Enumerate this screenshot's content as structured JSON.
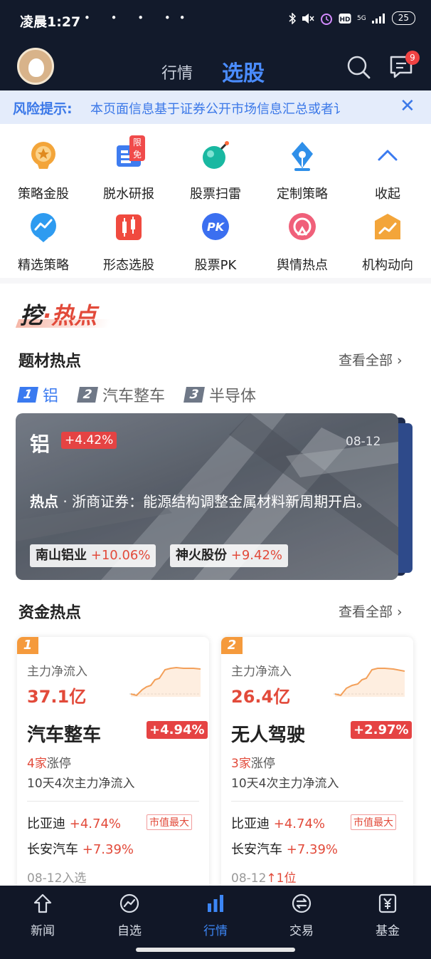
{
  "status_bar": {
    "time": "凌晨1:27",
    "left_icons": "• • • ••",
    "net": "5G",
    "battery": "25"
  },
  "header": {
    "tabs": [
      "行情",
      "选股"
    ],
    "active_tab": "选股",
    "message_badge": "9",
    "colors": {
      "bg": "#121a2b",
      "accent": "#4a8cff"
    }
  },
  "risk_banner": {
    "label": "风险提示:",
    "text": "本页面信息基于证券公开市场信息汇总或者讠"
  },
  "tools": [
    {
      "label": "策略金股",
      "icon": "gold-stock-icon"
    },
    {
      "label": "脱水研报",
      "icon": "report-icon",
      "tag": "限免"
    },
    {
      "label": "股票扫雷",
      "icon": "mine-scan-icon"
    },
    {
      "label": "定制策略",
      "icon": "pen-nib-icon"
    },
    {
      "label": "收起",
      "icon": "collapse-chevron-icon"
    },
    {
      "label": "精选策略",
      "icon": "selected-strategy-icon"
    },
    {
      "label": "形态选股",
      "icon": "candlestick-icon"
    },
    {
      "label": "股票PK",
      "icon": "pk-icon",
      "glyph": "PK"
    },
    {
      "label": "舆情热点",
      "icon": "sentiment-icon"
    },
    {
      "label": "机构动向",
      "icon": "institution-icon"
    }
  ],
  "hot": {
    "section_logo": {
      "part1": "挖",
      "dot": "·",
      "part2": "热点"
    },
    "topic_title": "题材热点",
    "see_all": "查看全部 ›",
    "topic_tabs": [
      {
        "num": "1",
        "label": "铝"
      },
      {
        "num": "2",
        "label": "汽车整车"
      },
      {
        "num": "3",
        "label": "半导体"
      }
    ],
    "card": {
      "title": "铝",
      "pct": "+4.42%",
      "date": "08-12",
      "desc_label": "热点",
      "desc_sep": "·",
      "desc": "浙商证券：能源结构调整金属材料新周期开启。",
      "stocks": [
        {
          "name": "南山铝业",
          "pct": "+10.06%"
        },
        {
          "name": "神火股份",
          "pct": "+9.42%"
        }
      ]
    }
  },
  "fund": {
    "title": "资金热点",
    "see_all": "查看全部 ›",
    "cards": [
      {
        "rank": "1",
        "label": "主力净流入",
        "value": "37.1亿",
        "sector": "汽车整车",
        "pct": "+4.94%",
        "limit_count": "4家",
        "limit_text": "涨停",
        "flow": "10天4次主力净流入",
        "stock1": {
          "name": "比亚迪",
          "pct": "+4.74%"
        },
        "tag": "市值最大",
        "stock2": {
          "name": "长安汽车",
          "pct": "+7.39%"
        },
        "date": "08-12入选",
        "date_extra": ""
      },
      {
        "rank": "2",
        "label": "主力净流入",
        "value": "26.4亿",
        "sector": "无人驾驶",
        "pct": "+2.97%",
        "limit_count": "3家",
        "limit_text": "涨停",
        "flow": "10天4次主力净流入",
        "stock1": {
          "name": "比亚迪",
          "pct": "+4.74%"
        },
        "tag": "市值最大",
        "stock2": {
          "name": "长安汽车",
          "pct": "+7.39%"
        },
        "date": "08-12",
        "date_extra": "↑1位"
      }
    ]
  },
  "bottom_nav": {
    "items": [
      "新闻",
      "自选",
      "行情",
      "交易",
      "基金"
    ],
    "active": "行情"
  }
}
